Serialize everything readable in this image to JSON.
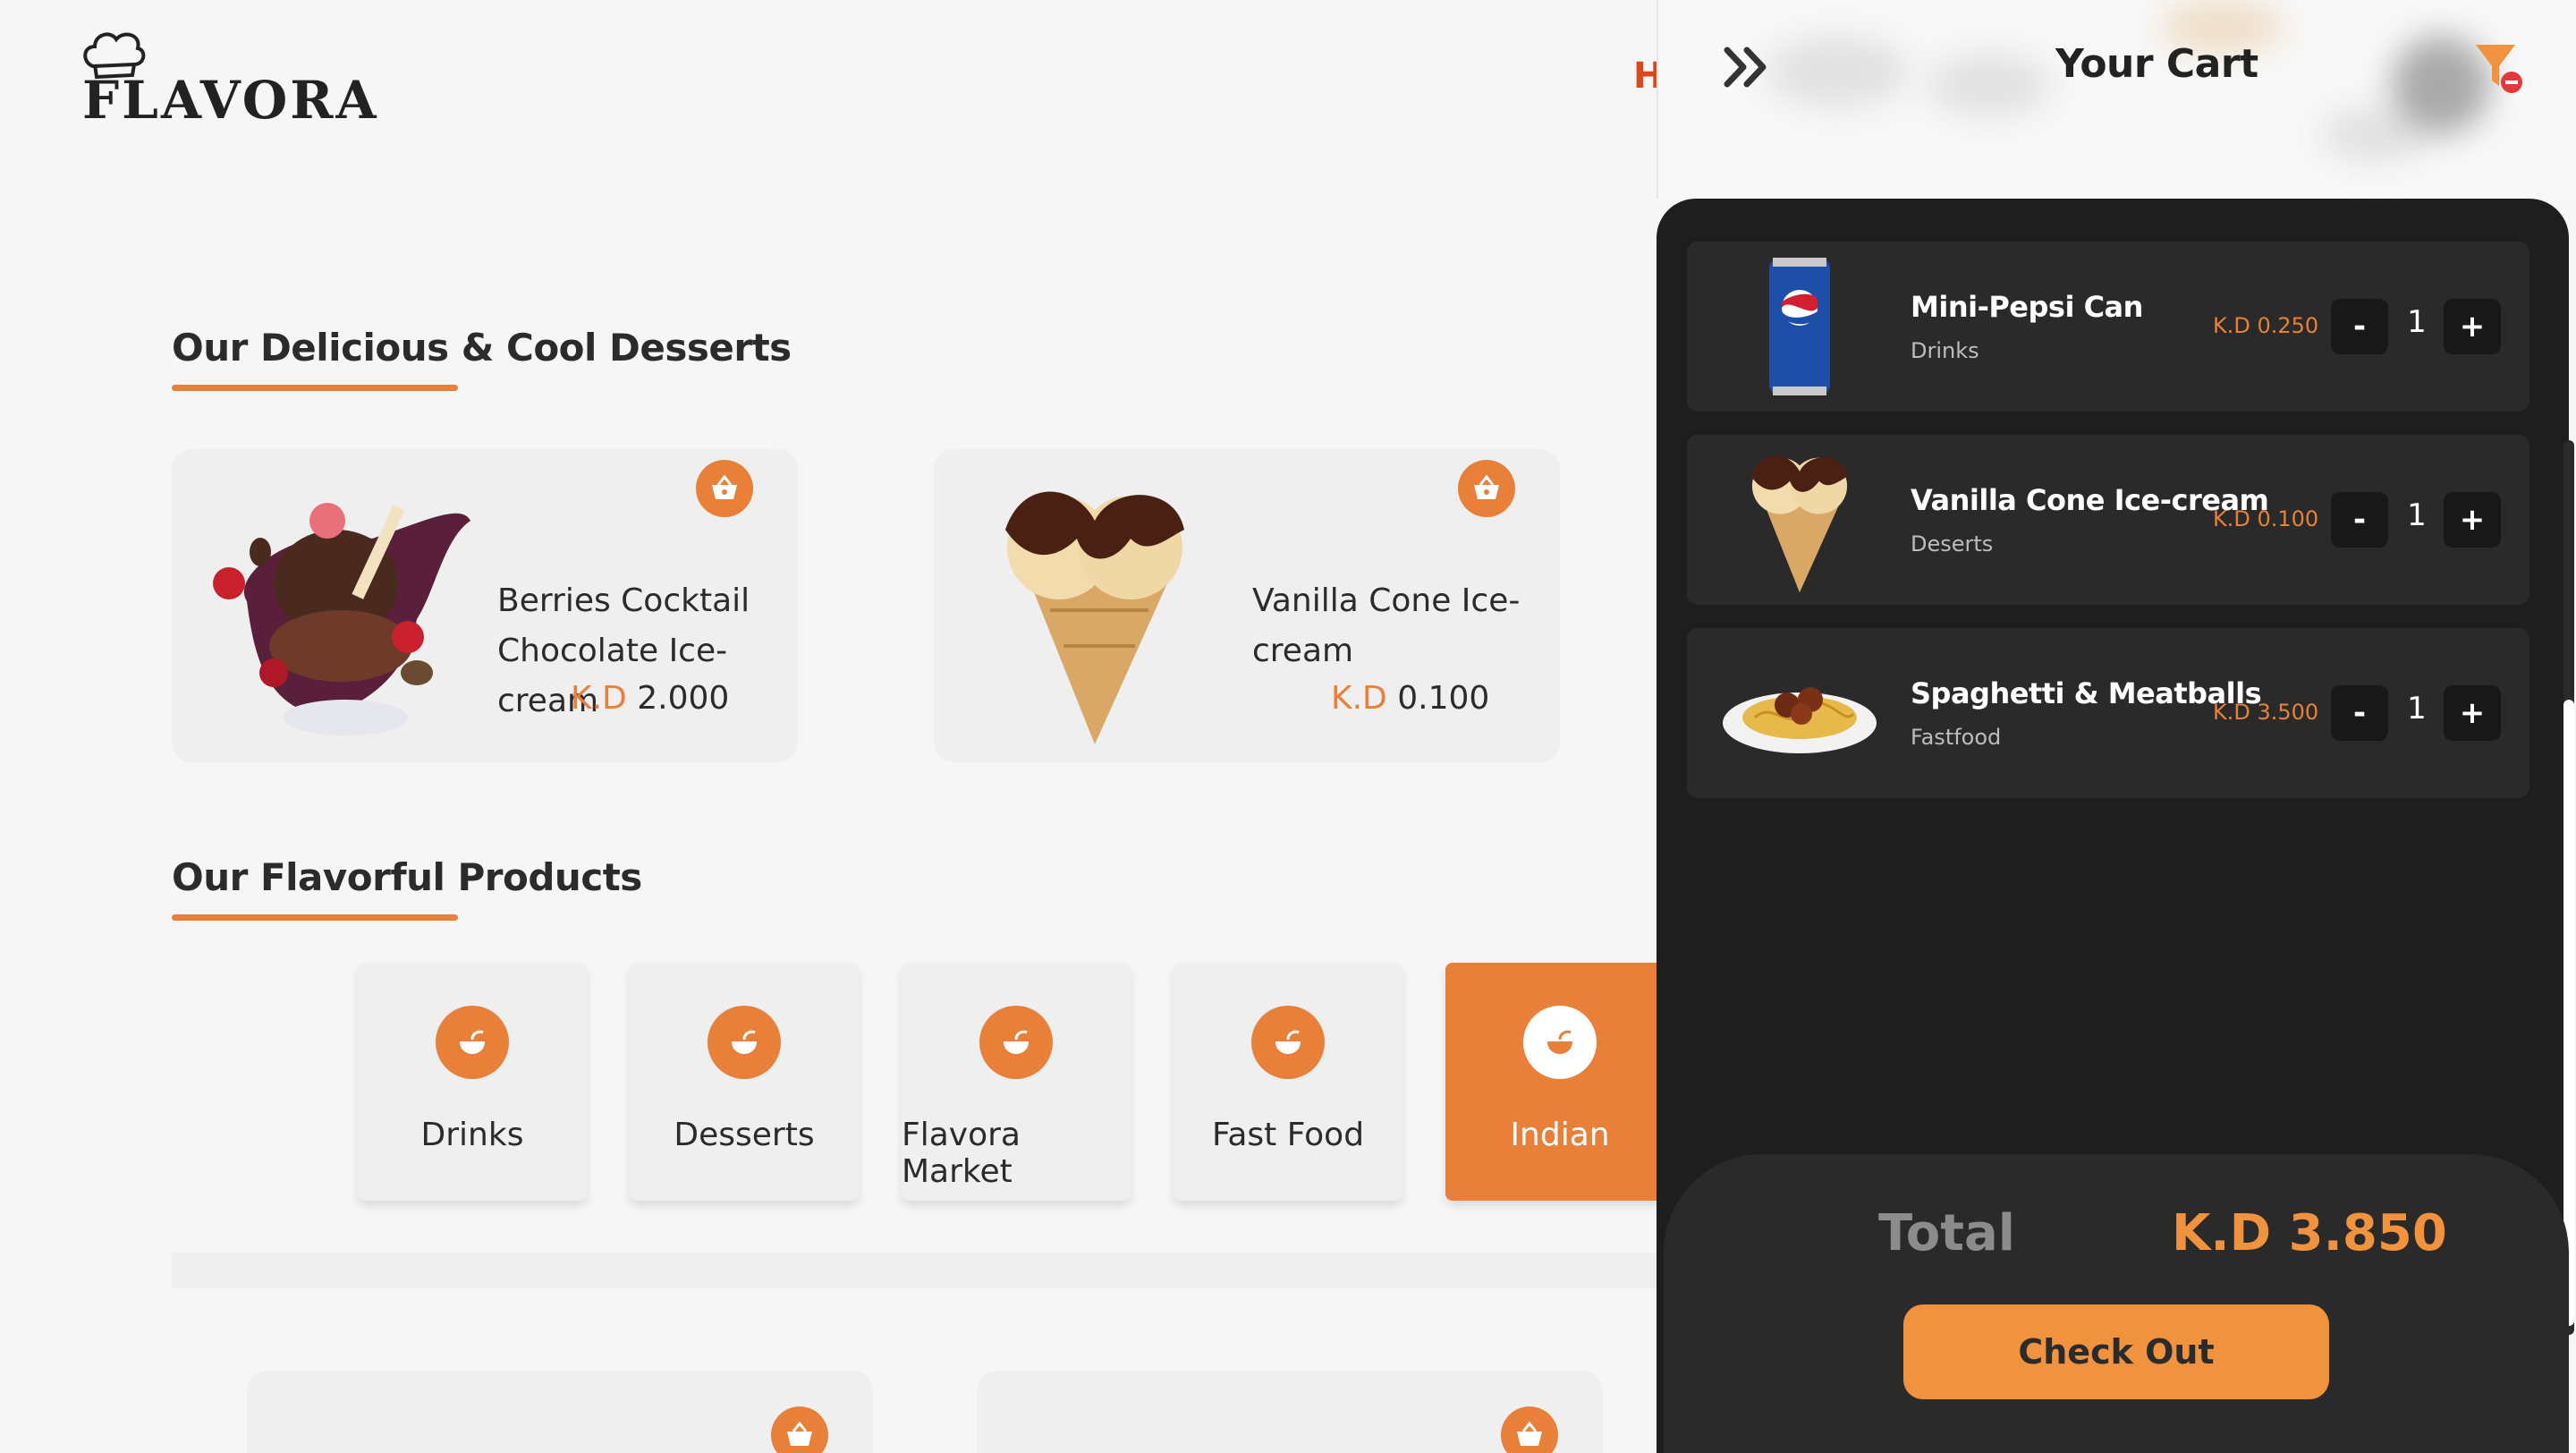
{
  "brand": {
    "logo_text": "FLAVORA",
    "nav_peek": "H"
  },
  "desserts_section": {
    "title": "Our Delicious & Cool Desserts",
    "items": [
      {
        "name_line1": "Berries Cocktail",
        "name_line2": "Chocolate Ice-cream",
        "currency": "K.D",
        "price": "2.000"
      },
      {
        "name_line1": "Vanilla Cone Ice-",
        "name_line2": "cream",
        "currency": "K.D",
        "price": "0.100"
      }
    ]
  },
  "products_section": {
    "title": "Our Flavorful Products",
    "categories": [
      {
        "label": "Drinks",
        "active": false
      },
      {
        "label": "Desserts",
        "active": false
      },
      {
        "label": "Flavora Market",
        "active": false
      },
      {
        "label": "Fast Food",
        "active": false
      },
      {
        "label": "Indian",
        "active": true
      }
    ]
  },
  "cart": {
    "title": "Your Cart",
    "items": [
      {
        "name": "Mini-Pepsi Can",
        "category": "Drinks",
        "price": "K.D 0.250",
        "qty": "1",
        "minus": "-",
        "plus": "+"
      },
      {
        "name": "Vanilla Cone Ice-cream",
        "category": "Deserts",
        "price": "K.D 0.100",
        "qty": "1",
        "minus": "-",
        "plus": "+"
      },
      {
        "name": "Spaghetti & Meatballs",
        "category": "Fastfood",
        "price": "K.D 3.500",
        "qty": "1",
        "minus": "-",
        "plus": "+"
      }
    ],
    "total_label": "Total",
    "total_value": "K.D 3.850",
    "checkout_label": "Check Out"
  },
  "colors": {
    "accent": "#e8803a",
    "cart_bg": "#1e1e1e",
    "cart_item_bg": "#2a2a2a",
    "checkout": "#f0923e"
  }
}
